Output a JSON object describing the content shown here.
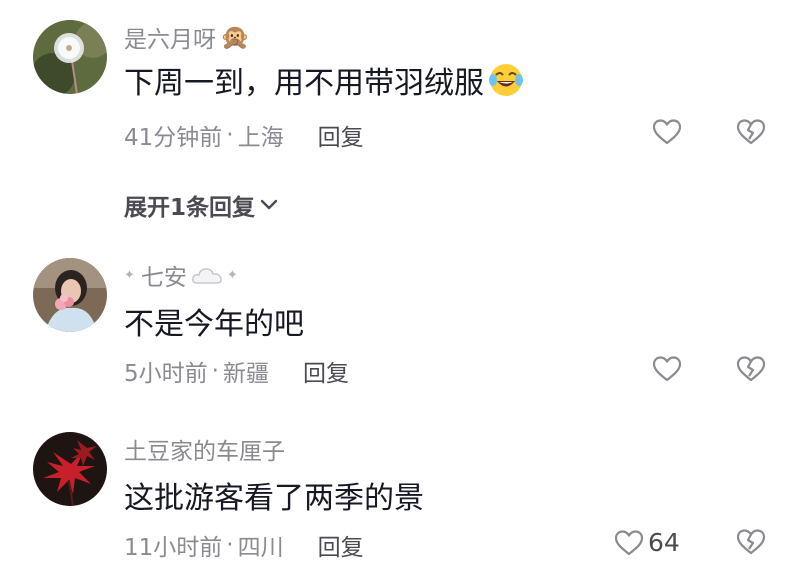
{
  "comments": [
    {
      "username": "是六月呀",
      "username_emoji": "🙊",
      "text": "下周一到，用不用带羽绒服",
      "text_emoji": "laughing-tears-emoji",
      "time": "41分钟前",
      "location": "上海",
      "reply_label": "回复",
      "like_count": ""
    },
    {
      "username": "七安",
      "text": "不是今年的吧",
      "time": "5小时前",
      "location": "新疆",
      "reply_label": "回复",
      "like_count": ""
    },
    {
      "username": "土豆家的车厘子",
      "text": "这批游客看了两季的景",
      "time": "11小时前",
      "location": "四川",
      "reply_label": "回复",
      "like_count": "64"
    }
  ],
  "expand_replies_label": "展开1条回复",
  "meta_separator": "·",
  "icons": {
    "like": "heart-outline-icon",
    "dislike": "broken-heart-icon",
    "expand": "chevron-down-icon"
  },
  "colors": {
    "text_primary": "#161823",
    "text_secondary": "#8a8b91",
    "reply": "#4a4b52"
  }
}
